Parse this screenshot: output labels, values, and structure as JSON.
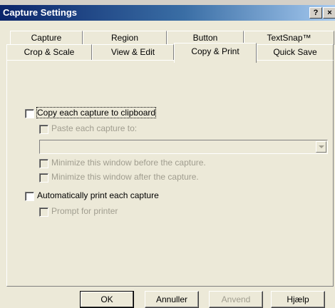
{
  "window": {
    "title": "Capture Settings",
    "help_glyph": "?",
    "close_glyph": "×"
  },
  "tabs": {
    "row_back": [
      "Capture",
      "Region",
      "Button",
      "TextSnap™"
    ],
    "row_front": [
      "Crop & Scale",
      "View & Edit",
      "Copy & Print",
      "Quick Save"
    ],
    "active": "Copy & Print"
  },
  "options": {
    "copy_clipboard": {
      "label": "Copy each capture to clipboard",
      "checked": false,
      "enabled": true
    },
    "paste_each": {
      "label": "Paste each capture to:",
      "checked": false,
      "enabled": false
    },
    "paste_target": {
      "value": "",
      "enabled": false
    },
    "minimize_before": {
      "label": "Minimize this window before the capture.",
      "checked": false,
      "enabled": false
    },
    "minimize_after": {
      "label": "Minimize this window after the capture.",
      "checked": false,
      "enabled": false
    },
    "auto_print": {
      "label": "Automatically print each capture",
      "checked": false,
      "enabled": true
    },
    "prompt_printer": {
      "label": "Prompt for printer",
      "checked": false,
      "enabled": false
    }
  },
  "buttons": {
    "ok": "OK",
    "cancel": "Annuller",
    "apply": "Anvend",
    "help": "Hjælp"
  }
}
